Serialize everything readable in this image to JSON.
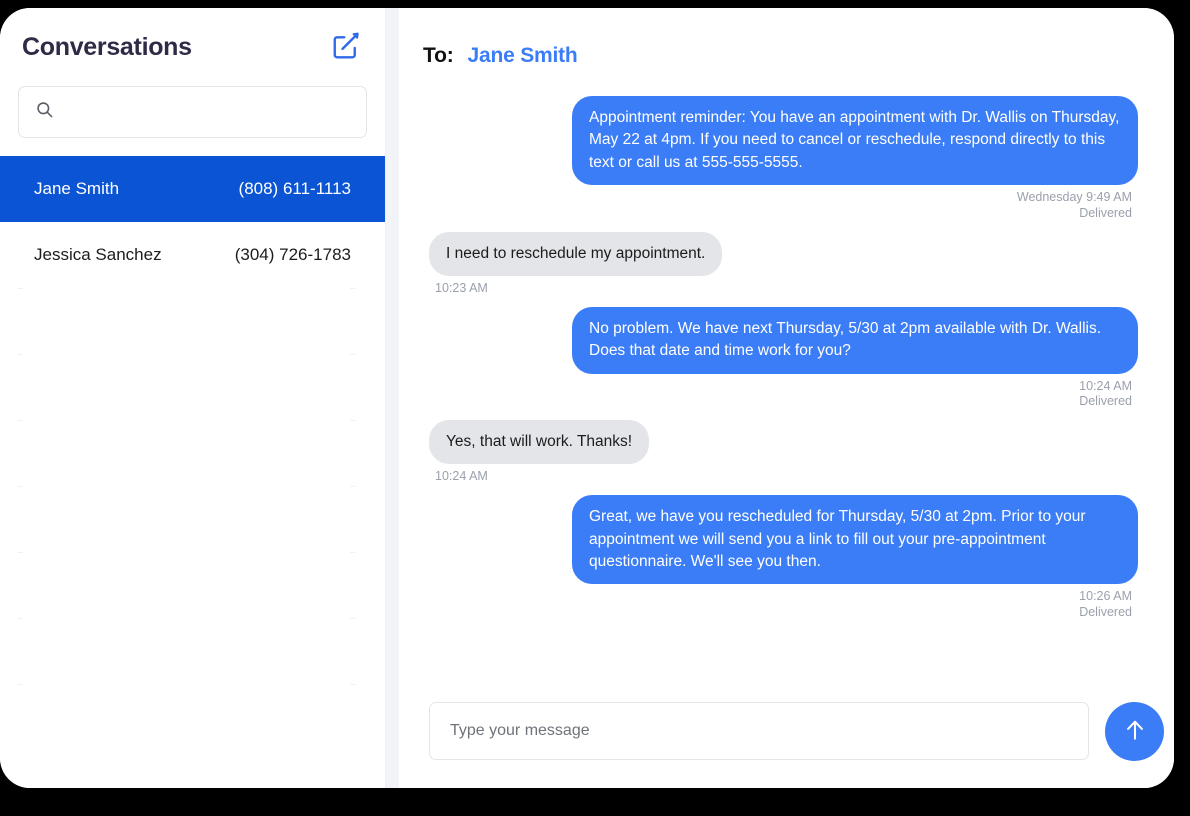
{
  "sidebar": {
    "title": "Conversations",
    "compose_icon": "compose-pencil-square-icon",
    "search": {
      "icon": "search-icon",
      "value": "",
      "placeholder": ""
    },
    "conversations": [
      {
        "name": "Jane Smith",
        "phone": "(808) 611-1113",
        "selected": true
      },
      {
        "name": "Jessica Sanchez",
        "phone": "(304) 726-1783",
        "selected": false
      }
    ],
    "empty_row_count": 7
  },
  "panel": {
    "to_label": "To:",
    "recipient": "Jane Smith",
    "messages": [
      {
        "direction": "out",
        "text": "Appointment reminder: You have an appointment with Dr. Wallis on Thursday, May 22 at 4pm. If you need to cancel or reschedule, respond directly to this text or call us at 555-555-5555.",
        "time": "Wednesday 9:49 AM",
        "status": "Delivered"
      },
      {
        "direction": "in",
        "text": "I need to reschedule my appointment.",
        "time": "10:23 AM",
        "status": ""
      },
      {
        "direction": "out",
        "text": "No problem. We have next Thursday, 5/30 at 2pm available with Dr. Wallis. Does that date and time work for you?",
        "time": "10:24 AM",
        "status": "Delivered"
      },
      {
        "direction": "in",
        "text": "Yes, that will work. Thanks!",
        "time": "10:24 AM",
        "status": ""
      },
      {
        "direction": "out",
        "text": "Great, we have you rescheduled for Thursday, 5/30 at 2pm. Prior to your appointment we will send you a link to fill out your pre-appointment questionnaire. We'll see you then.",
        "time": "10:26 AM",
        "status": "Delivered"
      }
    ],
    "composer": {
      "value": "",
      "placeholder": "Type your message",
      "send_icon": "arrow-up-icon"
    }
  },
  "colors": {
    "selected_row_blue": "#0b55d4",
    "bubble_blue": "#3b7df6",
    "bubble_gray": "#e4e5e8",
    "accent_blue": "#3b7df6",
    "title_dark": "#2f2a46",
    "meta_gray": "#9aa0ac",
    "panel_divider": "#f2f4f8"
  }
}
